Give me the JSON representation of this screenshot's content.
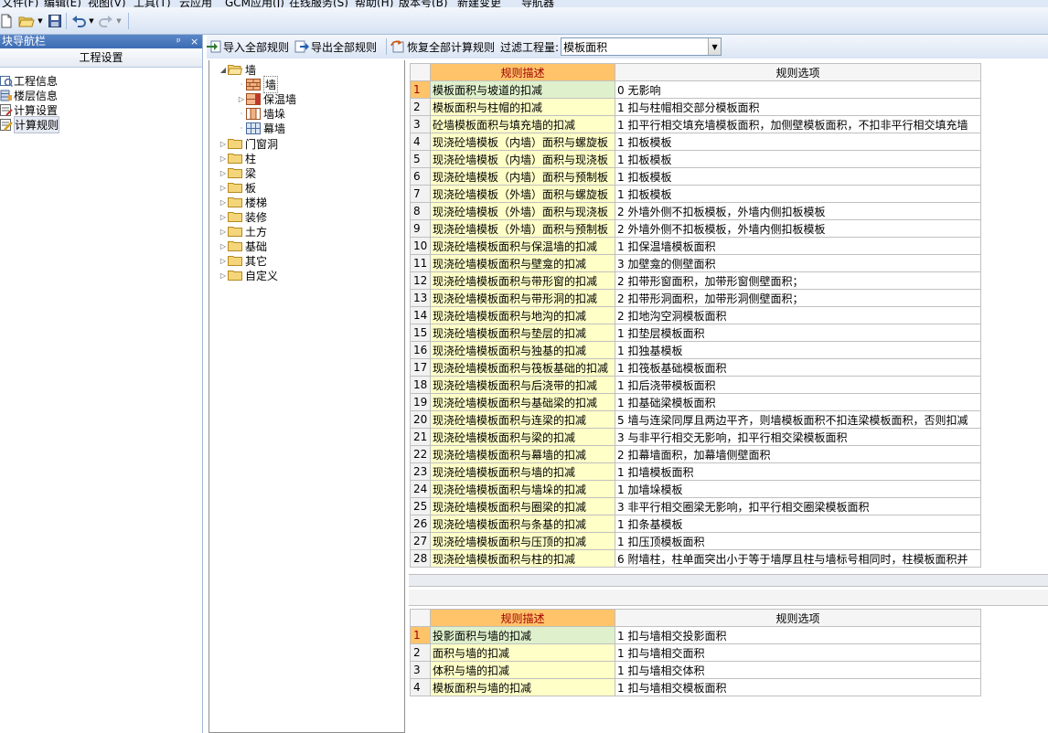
{
  "menubar": {
    "items": [
      "文件(F)",
      "编辑(E)",
      "视图(V)",
      "工具(T)",
      "云应用",
      "GCM应用(J)",
      "在线服务(S)",
      "帮助(H)",
      "版本号(B)",
      "新建变更",
      "导航器"
    ]
  },
  "toolbar": {
    "icons": [
      "new-file-icon",
      "open-folder-icon",
      "save-icon",
      "undo-icon",
      "redo-icon"
    ]
  },
  "nav": {
    "title": "块导航栏",
    "pin_glyph": "ᵖ",
    "close_glyph": "×",
    "group_label": "工程设置",
    "items": [
      {
        "label": "工程信息",
        "icon": "project-info-icon"
      },
      {
        "label": "楼层信息",
        "icon": "floor-info-icon"
      },
      {
        "label": "计算设置",
        "icon": "calc-settings-icon"
      },
      {
        "label": "计算规则",
        "icon": "calc-rules-icon"
      }
    ]
  },
  "rule_toolbar": {
    "import_label": "导入全部规则",
    "export_label": "导出全部规则",
    "restore_label": "恢复全部计算规则",
    "filter_label": "过滤工程量:",
    "filter_value": "模板面积"
  },
  "tree": {
    "root": "墙",
    "children": [
      "墙",
      "保温墙",
      "墙垛",
      "幕墙"
    ],
    "others": [
      "门窗洞",
      "柱",
      "梁",
      "板",
      "楼梯",
      "装修",
      "土方",
      "基础",
      "其它",
      "自定义"
    ]
  },
  "grid1": {
    "header_desc": "规则描述",
    "header_opt": "规则选项",
    "rows": [
      {
        "num": "1",
        "desc": "模板面积与坡道的扣减",
        "opt": "0   无影响"
      },
      {
        "num": "2",
        "desc": "模板面积与柱帽的扣减",
        "opt": "1 扣与柱帽相交部分模板面积"
      },
      {
        "num": "3",
        "desc": "砼墙模板面积与填充墙的扣减",
        "opt": "1 扣平行相交填充墙模板面积，加侧壁模板面积，不扣非平行相交填充墙"
      },
      {
        "num": "4",
        "desc": "现浇砼墙模板（内墙）面积与螺旋板",
        "opt": "1   扣板模板"
      },
      {
        "num": "5",
        "desc": "现浇砼墙模板（内墙）面积与现浇板",
        "opt": "1   扣板模板"
      },
      {
        "num": "6",
        "desc": "现浇砼墙模板（内墙）面积与预制板",
        "opt": "1   扣板模板"
      },
      {
        "num": "7",
        "desc": "现浇砼墙模板（外墙）面积与螺旋板",
        "opt": "1   扣板模板"
      },
      {
        "num": "8",
        "desc": "现浇砼墙模板（外墙）面积与现浇板",
        "opt": "2   外墙外侧不扣板模板，外墙内侧扣板模板"
      },
      {
        "num": "9",
        "desc": "现浇砼墙模板（外墙）面积与预制板",
        "opt": "2   外墙外侧不扣板模板，外墙内侧扣板模板"
      },
      {
        "num": "10",
        "desc": "现浇砼墙模板面积与保温墙的扣减",
        "opt": "1   扣保温墙模板面积"
      },
      {
        "num": "11",
        "desc": "现浇砼墙模板面积与壁龛的扣减",
        "opt": "3   加壁龛的侧壁面积"
      },
      {
        "num": "12",
        "desc": "现浇砼墙模板面积与带形窗的扣减",
        "opt": "2   扣带形窗面积，加带形窗侧壁面积；"
      },
      {
        "num": "13",
        "desc": "现浇砼墙模板面积与带形洞的扣减",
        "opt": "2   扣带形洞面积，加带形洞侧壁面积；"
      },
      {
        "num": "14",
        "desc": "现浇砼墙模板面积与地沟的扣减",
        "opt": "2   扣地沟空洞模板面积"
      },
      {
        "num": "15",
        "desc": "现浇砼墙模板面积与垫层的扣减",
        "opt": "1   扣垫层模板面积"
      },
      {
        "num": "16",
        "desc": "现浇砼墙模板面积与独基的扣减",
        "opt": "1   扣独基模板"
      },
      {
        "num": "17",
        "desc": "现浇砼墙模板面积与筏板基础的扣减",
        "opt": "1   扣筏板基础模板面积"
      },
      {
        "num": "18",
        "desc": "现浇砼墙模板面积与后浇带的扣减",
        "opt": "1   扣后浇带模板面积"
      },
      {
        "num": "19",
        "desc": "现浇砼墙模板面积与基础梁的扣减",
        "opt": "1   扣基础梁模板面积"
      },
      {
        "num": "20",
        "desc": "现浇砼墙模板面积与连梁的扣减",
        "opt": "5 墙与连梁同厚且两边平齐，则墙模板面积不扣连梁模板面积，否则扣减"
      },
      {
        "num": "21",
        "desc": "现浇砼墙模板面积与梁的扣减",
        "opt": "3   与非平行相交无影响，扣平行相交梁模板面积"
      },
      {
        "num": "22",
        "desc": "现浇砼墙模板面积与幕墙的扣减",
        "opt": "2 扣幕墙面积，加幕墙侧壁面积"
      },
      {
        "num": "23",
        "desc": "现浇砼墙模板面积与墙的扣减",
        "opt": "1   扣墙模板面积"
      },
      {
        "num": "24",
        "desc": "现浇砼墙模板面积与墙垛的扣减",
        "opt": "1   加墙垛模板"
      },
      {
        "num": "25",
        "desc": "现浇砼墙模板面积与圈梁的扣减",
        "opt": "3   非平行相交圈梁无影响，扣平行相交圈梁模板面积"
      },
      {
        "num": "26",
        "desc": "现浇砼墙模板面积与条基的扣减",
        "opt": "1   扣条基模板"
      },
      {
        "num": "27",
        "desc": "现浇砼墙模板面积与压顶的扣减",
        "opt": "1   扣压顶模板面积"
      },
      {
        "num": "28",
        "desc": "现浇砼墙模板面积与柱的扣减",
        "opt": "6   附墙柱，柱单面突出小于等于墙厚且柱与墙标号相同时，柱模板面积并"
      }
    ]
  },
  "grid2": {
    "header_desc": "规则描述",
    "header_opt": "规则选项",
    "rows": [
      {
        "num": "1",
        "desc": "投影面积与墙的扣减",
        "opt": "1 扣与墙相交投影面积"
      },
      {
        "num": "2",
        "desc": "面积与墙的扣减",
        "opt": "1 扣与墙相交面积"
      },
      {
        "num": "3",
        "desc": "体积与墙的扣减",
        "opt": "1 扣与墙相交体积"
      },
      {
        "num": "4",
        "desc": "模板面积与墙的扣减",
        "opt": "1 扣与墙相交模板面积"
      }
    ]
  }
}
